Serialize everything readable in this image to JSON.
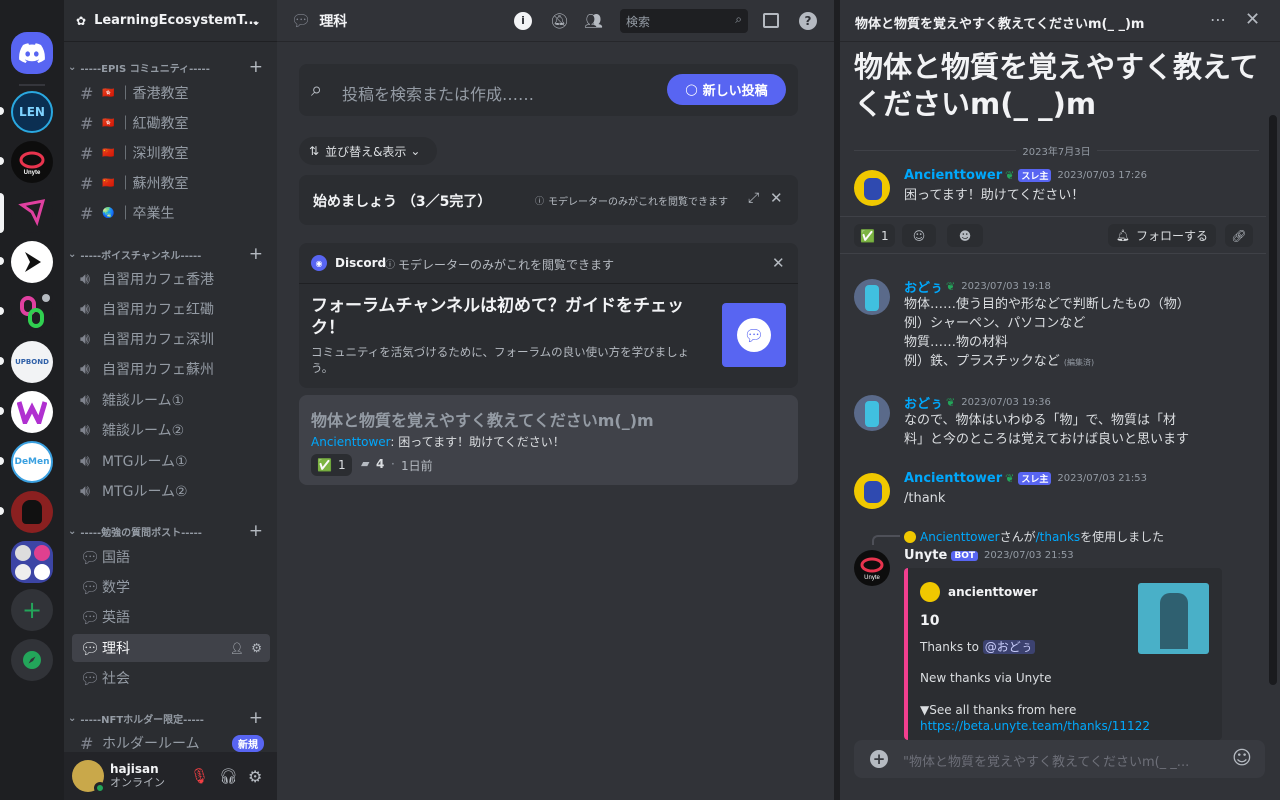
{
  "servers": [
    {
      "label": "Discord home",
      "color": "#5865f2"
    },
    {
      "label": "LEN",
      "color": "#1a6fb5"
    },
    {
      "label": "Unyte",
      "color": "#111"
    },
    {
      "label": "arrow",
      "color": "#2b2d31"
    },
    {
      "label": "play",
      "color": "#fff"
    },
    {
      "label": "link",
      "color": "#1e1f22"
    },
    {
      "label": "UPBOND",
      "color": "#f2f3f5"
    },
    {
      "label": "W",
      "color": "#fff"
    },
    {
      "label": "DeMen",
      "color": "#fff"
    },
    {
      "label": "ninja",
      "color": "#9b2c2c"
    },
    {
      "label": "folder",
      "color": "#5865f2"
    }
  ],
  "guild_name": "LearningEcosystemT...",
  "categories": [
    {
      "label": "-----EPIS コミュニティ-----"
    },
    {
      "label": "-----ボイスチャンネル-----"
    },
    {
      "label": "-----勉強の質問ポスト-----"
    },
    {
      "label": "-----NFTホルダー限定-----"
    }
  ],
  "channels": {
    "text": [
      {
        "flag": "🇭🇰",
        "label": "香港教室"
      },
      {
        "flag": "🇭🇰",
        "label": "紅磡教室"
      },
      {
        "flag": "🇨🇳",
        "label": "深圳教室"
      },
      {
        "flag": "🇨🇳",
        "label": "蘇州教室"
      },
      {
        "flag": "🌏",
        "label": "卒業生"
      }
    ],
    "voice": [
      "自習用カフェ香港",
      "自習用カフェ红磡",
      "自習用カフェ深圳",
      "自習用カフェ蘇州",
      "雑談ルーム①",
      "雑談ルーム②",
      "MTGルーム①",
      "MTGルーム②"
    ],
    "forum": [
      "国語",
      "数学",
      "英語",
      "理科",
      "社会"
    ],
    "nft": {
      "label": "ホルダールーム",
      "badge": "新規"
    }
  },
  "user": {
    "name": "hajisan",
    "status": "オンライン"
  },
  "center": {
    "channel_title": "理科",
    "search_placeholder": "検索",
    "post_search_placeholder": "投稿を検索または作成……",
    "new_post_label": "新しい投稿",
    "sort_label": "並び替え&表示",
    "getting_started": "始めましょう （3／5完了）",
    "mod_only": "モデレーターのみがこれを閲覧できます",
    "discord_label": "Discord",
    "guide_title": "フォーラムチャンネルは初めて？ガイドをチェック！",
    "guide_body": "コミュニティを活気づけるために、フォーラムの良い使い方を学びましょう。",
    "post": {
      "title": "物体と物質を覚えやすく教えてくださいm(_)m",
      "author": "Ancienttower",
      "preview": ": 困ってます！助けてください！",
      "reactions": "1",
      "replies": "4",
      "age": "1日前"
    }
  },
  "thread": {
    "header": "物体と物質を覚えやすく教えてくださいm(_ _)m",
    "title": "物体と物質を覚えやすく教えてくださいm(_ _)m",
    "date_divider": "2023年7月3日",
    "follow_label": "フォローする",
    "reaction_count": "1",
    "op_tag": "スレ主",
    "messages": [
      {
        "author": "Ancienttower",
        "time": "2023/07/03 17:26",
        "lines": [
          "困ってます！助けてください！"
        ]
      },
      {
        "author": "おどぅ",
        "time": "2023/07/03 19:18",
        "lines": [
          "物体……使う目的や形などで判断したもの（物）",
          "例）シャーペン、パソコンなど",
          "物質……物の材料",
          "例）鉄、プラスチックなど"
        ],
        "edited": "(編集済)"
      },
      {
        "author": "おどぅ",
        "time": "2023/07/03 19:36",
        "lines": [
          "なので、物体はいわゆる「物」で、物質は「材",
          "料」と今のところは覚えておけば良いと思います"
        ]
      },
      {
        "author": "Ancienttower",
        "time": "2023/07/03 21:53",
        "lines": [
          "/thank"
        ]
      }
    ],
    "system": {
      "user": "Ancienttower",
      "mid": "さんが",
      "cmd": "/thanks",
      "tail": "を使用しました"
    },
    "bot": {
      "name": "Unyte",
      "tag": "BOT",
      "time": "2023/07/03 21:53",
      "embed_author": "ancienttower",
      "embed_title": "10",
      "thanks_to": "Thanks to",
      "mention": "@おどぅ",
      "via": "New thanks via Unyte",
      "see_all": "▼See all thanks from here",
      "link": "https://beta.unyte.team/thanks/11122"
    },
    "composer_placeholder": "\"物体と物質を覚えやすく教えてくださいm(_ _..."
  },
  "colors": {
    "blurple": "#5865f2",
    "link": "#00a8fc",
    "green": "#23a55a",
    "embed": "#f23f8f"
  }
}
